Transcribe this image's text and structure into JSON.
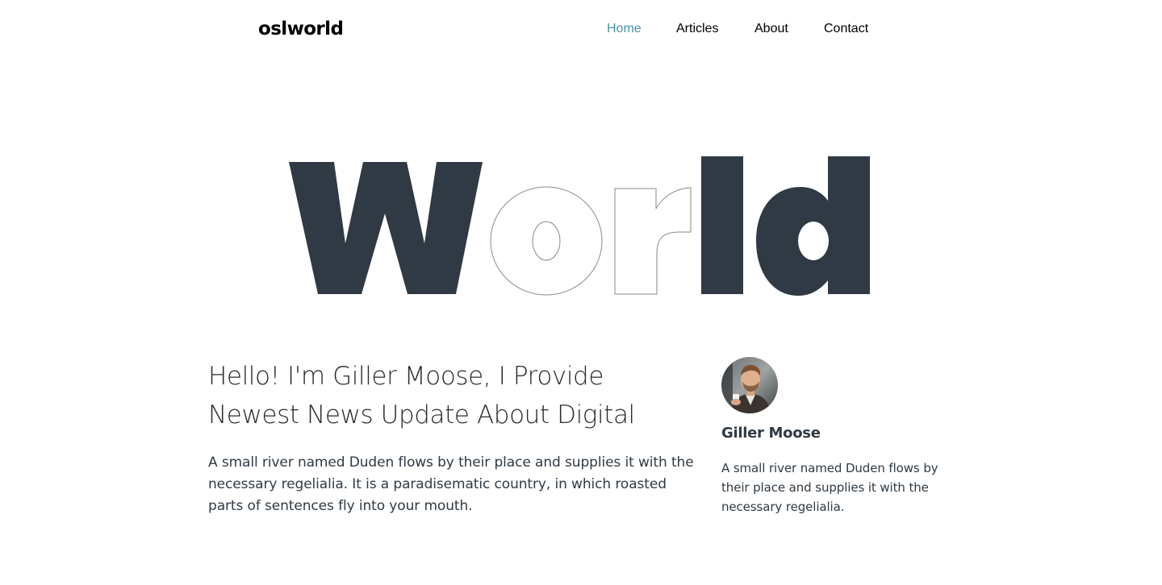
{
  "nav": {
    "logo": "oslworld",
    "items": [
      {
        "label": "Home",
        "active": true
      },
      {
        "label": "Articles",
        "active": false
      },
      {
        "label": "About",
        "active": false
      },
      {
        "label": "Contact",
        "active": false
      }
    ]
  },
  "hero": {
    "word": "World",
    "filled_color": "#2f3a44",
    "outline_color": "#8a8a8a"
  },
  "intro": {
    "heading_line1": "Hello! I'm Giller Moose, I Provide",
    "heading_line2": "Newest News Update About Digital",
    "body": "A small river named Duden flows by their place and supplies it with the necessary regelialia. It is a paradisematic country, in which roasted parts of sentences fly into your mouth."
  },
  "author": {
    "name": "Giller Moose",
    "bio": "A small river named Duden flows by their place and supplies it with the necessary regelialia."
  },
  "colors": {
    "accent": "#4a8fb1",
    "text": "#2f3a44"
  }
}
